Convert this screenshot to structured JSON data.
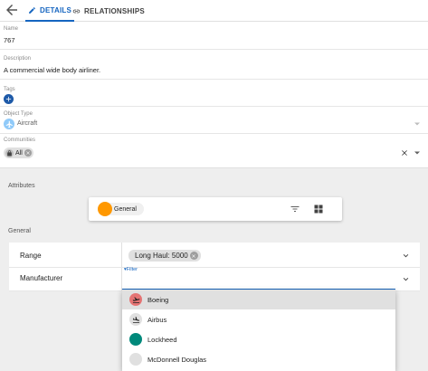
{
  "tabs": [
    {
      "label": "DETAILS",
      "active": true
    },
    {
      "label": "RELATIONSHIPS",
      "active": false
    }
  ],
  "fields": {
    "name": {
      "label": "Name",
      "value": "767"
    },
    "description": {
      "label": "Description",
      "value": "A commercial wide body airliner."
    },
    "tags": {
      "label": "Tags"
    },
    "object_type": {
      "label": "Object Type",
      "value": "Aircraft"
    },
    "communities": {
      "label": "Communities",
      "chip": "All"
    }
  },
  "attributes": {
    "section_label": "Attributes",
    "selected_group": "General",
    "group_color": "#ff9800"
  },
  "general": {
    "section_label": "General",
    "rows": [
      {
        "name": "Range",
        "value": "Long Haul: 5000"
      },
      {
        "name": "Manufacturer",
        "filter_placeholder": "Filter"
      }
    ]
  },
  "manufacturer_options": [
    {
      "label": "Boeing",
      "color": "#e57373",
      "icon": "airplane-takeoff-icon",
      "selected": true
    },
    {
      "label": "Airbus",
      "color": "#e0e0e0",
      "icon": "airplane-landing-icon",
      "selected": false
    },
    {
      "label": "Lockheed",
      "color": "#00897b",
      "icon": "",
      "selected": false
    },
    {
      "label": "McDonnell Douglas",
      "color": "#e0e0e0",
      "icon": "",
      "selected": false
    }
  ],
  "colors": {
    "accent": "#1565c0",
    "add_button": "#1e5aa8"
  }
}
